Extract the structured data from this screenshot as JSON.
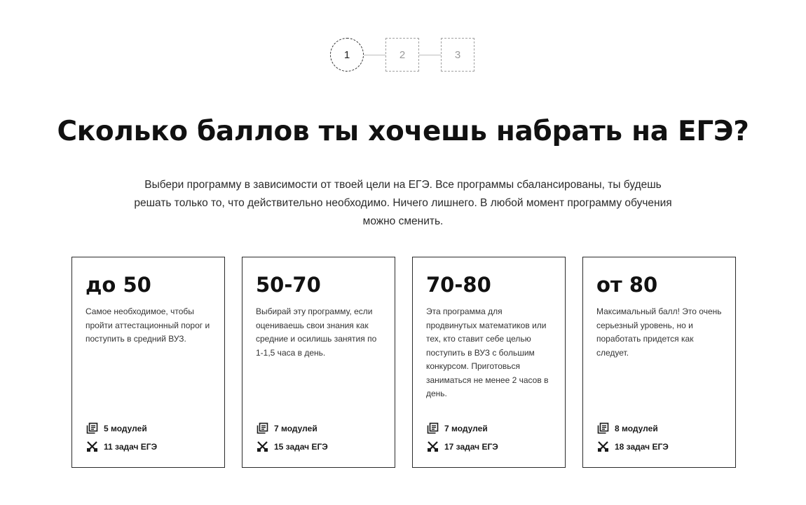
{
  "stepper": {
    "steps": [
      {
        "label": "1",
        "state": "active"
      },
      {
        "label": "2",
        "state": "inactive"
      },
      {
        "label": "3",
        "state": "inactive"
      }
    ]
  },
  "heading": {
    "title": "Сколько баллов ты хочешь набрать на ЕГЭ?",
    "subtitle": "Выбери программу в зависимости от твоей цели на ЕГЭ. Все программы сбалансированы, ты будешь решать только то, что действительно необходимо. Ничего лишнего. В любой момент программу обучения можно сменить."
  },
  "cards": [
    {
      "score": "до 50",
      "description": "Самое необходимое, чтобы пройти аттестационный порог и поступить в средний ВУЗ.",
      "modules": "5 модулей",
      "tasks": "11 задач ЕГЭ"
    },
    {
      "score": "50-70",
      "description": "Выбирай эту программу, если оцениваешь свои знания как средние и осилишь занятия по 1-1,5 часа в день.",
      "modules": "7 модулей",
      "tasks": "15 задач ЕГЭ"
    },
    {
      "score": "70-80",
      "description": "Эта программа для продвинутых математиков или тех, кто ставит себе целью поступить в ВУЗ с большим конкурсом. Приготовься заниматься не менее 2 часов в день.",
      "modules": "7 модулей",
      "tasks": "17 задач ЕГЭ"
    },
    {
      "score": "от 80",
      "description": "Максимальный балл! Это очень серьезный уровень, но и поработать придется как следует.",
      "modules": "8 модулей",
      "tasks": "18 задач ЕГЭ"
    }
  ],
  "icons": {
    "modules": "modules-icon",
    "tasks": "tasks-icon"
  },
  "colors": {
    "text": "#111111",
    "border": "#2b2b2b",
    "step_inactive": "#a0a0a0",
    "background": "#ffffff"
  }
}
